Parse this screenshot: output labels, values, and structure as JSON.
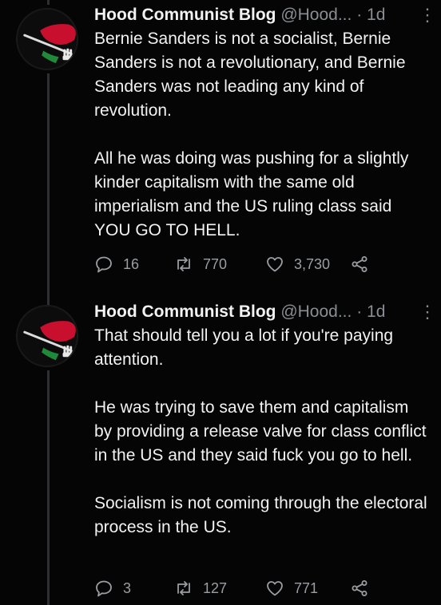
{
  "tweets": [
    {
      "name": "Hood Communist Blog",
      "handle": "@Hood...",
      "separator": "·",
      "time": "1d",
      "more_icon": "⋮",
      "paragraphs": [
        "Bernie Sanders is not a socialist, Bernie Sanders is not a revolutionary, and Bernie Sanders was not leading any kind of revolution.",
        "All he was doing was pushing for a slightly kinder capitalism with the same old imperialism and the US ruling class said YOU GO TO HELL."
      ],
      "replies": "16",
      "retweets": "770",
      "likes": "3,730"
    },
    {
      "name": "Hood Communist Blog",
      "handle": "@Hood...",
      "separator": "·",
      "time": "1d",
      "more_icon": "⋮",
      "paragraphs": [
        "That should tell you a lot if you're paying attention.",
        "He was trying to save them and capitalism by providing a release valve for class conflict in the US and they said fuck you go to hell.",
        "Socialism is not coming through the electoral process in the US."
      ],
      "replies": "3",
      "retweets": "127",
      "likes": "771"
    }
  ],
  "icons": {
    "reply": "reply-icon",
    "retweet": "retweet-icon",
    "like": "heart-icon",
    "share": "share-icon",
    "avatar": "raised-fist-avatar"
  },
  "colors": {
    "background": "#050505",
    "text": "#f2f2f2",
    "secondary": "#8a8d91",
    "avatar_red": "#c8102e",
    "avatar_green": "#1f8a3b",
    "thread_line": "#2c2f33"
  }
}
